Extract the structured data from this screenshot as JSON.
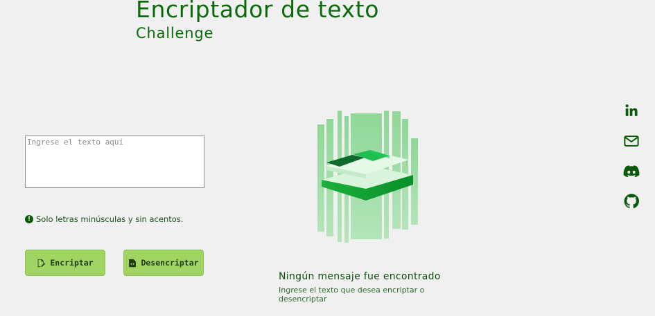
{
  "header": {
    "title": "Encriptador de texto",
    "subtitle": "Challenge"
  },
  "input": {
    "placeholder": "Ingrese el texto aquí",
    "value": ""
  },
  "hint": {
    "icon": "exclamation-circle-icon",
    "text": "Solo letras minúsculas y sin acentos."
  },
  "buttons": {
    "encrypt_label": "Encriptar",
    "encrypt_icon": "file-pen-icon",
    "decrypt_label": "Desencriptar",
    "decrypt_icon": "file-code-icon"
  },
  "output": {
    "empty_title": "Ningún mensaje fue encontrado",
    "empty_subtitle": "Ingrese el texto que desea encriptar o desencriptar"
  },
  "social": [
    {
      "name": "linkedin-icon"
    },
    {
      "name": "mail-icon"
    },
    {
      "name": "discord-icon"
    },
    {
      "name": "github-icon"
    }
  ],
  "colors": {
    "background": "#f0f0f0",
    "primary_text": "#0b6a0b",
    "button_bg": "#a0d563",
    "icon_color": "#0b5a0b"
  }
}
